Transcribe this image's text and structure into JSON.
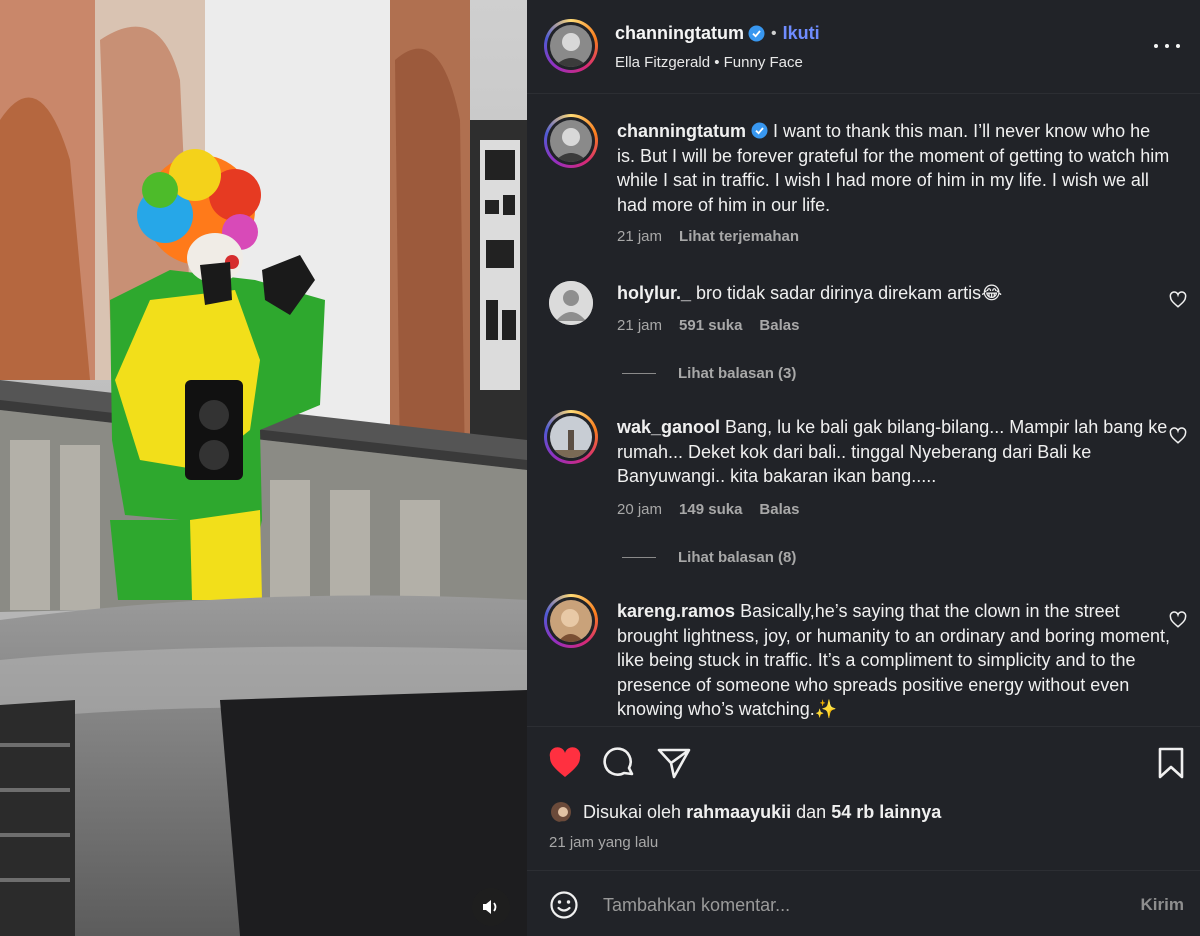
{
  "post": {
    "author": {
      "username": "channingtatum",
      "verified_icon": "verified-badge-icon",
      "follow_label": "Ikuti",
      "music_artist": "Ella Fitzgerald",
      "music_title": "Funny Face"
    },
    "caption": {
      "username": "channingtatum",
      "text": "I want to thank this man. I’ll never know who he is. But I will be forever grateful for the moment of getting to watch him while I sat in traffic. I wish I had more of him in my life. I wish we all had more of him in our life.",
      "time": "21 jam",
      "translate_label": "Lihat terjemahan"
    },
    "comments": [
      {
        "username": "holylur._",
        "text": "bro tidak sadar dirinya direkam artis",
        "emoji": "😂",
        "time": "21 jam",
        "likes": "591 suka",
        "reply_label": "Balas",
        "view_replies": "Lihat balasan (3)"
      },
      {
        "username": "wak_ganool",
        "text": "Bang, lu ke bali gak bilang-bilang... Mampir lah bang ke rumah... Deket kok dari bali.. tinggal Nyeberang dari Bali ke Banyuwangi.. kita bakaran ikan bang.....",
        "time": "20 jam",
        "likes": "149 suka",
        "reply_label": "Balas",
        "view_replies": "Lihat balasan (8)"
      },
      {
        "username": "kareng.ramos",
        "text": "Basically,he’s saying that the clown in the street brought lightness, joy, or humanity to an ordinary and boring moment, like being stuck in traffic. It’s a compliment to simplicity and to the presence of someone who spreads positive energy without even knowing who’s watching.",
        "emoji": "✨"
      }
    ],
    "likes_line": {
      "prefix": "Disukai oleh",
      "user": "rahmaayukii",
      "conj": "dan",
      "count": "54 rb lainnya"
    },
    "timestamp": "21 jam yang lalu",
    "add_comment": {
      "placeholder": "Tambahkan komentar...",
      "post_label": "Kirim"
    },
    "icons": {
      "like": "heart-filled-icon",
      "comment": "comment-icon",
      "share": "share-icon",
      "save": "bookmark-icon",
      "more": "more-icon",
      "emoji": "emoji-icon",
      "sound": "speaker-icon"
    },
    "colors": {
      "panel_bg": "#212328",
      "like_red": "#ff3040",
      "follow_blue": "#6f8cff",
      "verified_blue": "#3897f0"
    }
  }
}
